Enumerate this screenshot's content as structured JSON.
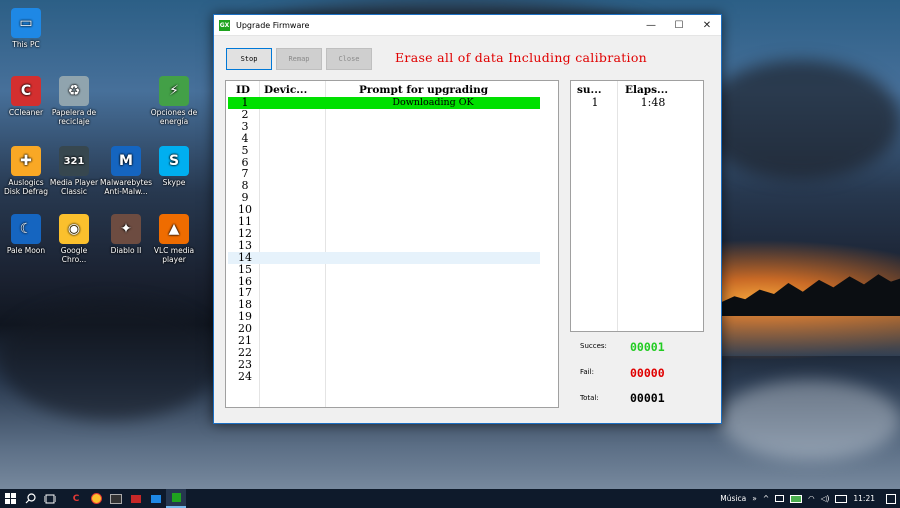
{
  "desktop": {
    "icons": [
      {
        "label": "This PC",
        "color": "#1e88e5",
        "glyph": "▭"
      },
      {
        "label": "CCleaner",
        "color": "#d32f2f",
        "glyph": "C"
      },
      {
        "label": "Papelera de reciclaje",
        "color": "#90a4ae",
        "glyph": "♻"
      },
      {
        "label": "Opciones de energía",
        "color": "#43a047",
        "glyph": "⚡"
      },
      {
        "label": "Auslogics Disk Defrag",
        "color": "#f9a825",
        "glyph": "✚"
      },
      {
        "label": "Media Player Classic",
        "color": "#37474f",
        "glyph": "321"
      },
      {
        "label": "Malwarebytes Anti-Malw...",
        "color": "#1565c0",
        "glyph": "M"
      },
      {
        "label": "Skype",
        "color": "#00aff0",
        "glyph": "S"
      },
      {
        "label": "Pale Moon",
        "color": "#1565c0",
        "glyph": "☾"
      },
      {
        "label": "Google Chro...",
        "color": "#fbc02d",
        "glyph": "◉"
      },
      {
        "label": "Diablo II",
        "color": "#6d4c41",
        "glyph": "✦"
      },
      {
        "label": "VLC media player",
        "color": "#ef6c00",
        "glyph": "▲"
      }
    ]
  },
  "window": {
    "title": "Upgrade Firmware",
    "app_icon_text": "GX",
    "minimize": "—",
    "maximize": "☐",
    "close": "✕"
  },
  "toolbar": {
    "stop_label": "Stop",
    "remap_label": "Remap",
    "close_label": "Close",
    "warning": "Erase all of data Including calibration"
  },
  "main_table": {
    "headers": {
      "id": "ID",
      "device": "Devic...",
      "prompt": "Prompt for upgrading"
    },
    "rows": [
      {
        "id": "1",
        "prompt": "Downloading OK",
        "status": "ok"
      },
      {
        "id": "2",
        "prompt": ""
      },
      {
        "id": "3",
        "prompt": ""
      },
      {
        "id": "4",
        "prompt": ""
      },
      {
        "id": "5",
        "prompt": ""
      },
      {
        "id": "6",
        "prompt": ""
      },
      {
        "id": "7",
        "prompt": ""
      },
      {
        "id": "8",
        "prompt": ""
      },
      {
        "id": "9",
        "prompt": ""
      },
      {
        "id": "10",
        "prompt": ""
      },
      {
        "id": "11",
        "prompt": ""
      },
      {
        "id": "12",
        "prompt": ""
      },
      {
        "id": "13",
        "prompt": ""
      },
      {
        "id": "14",
        "prompt": "",
        "status": "selected"
      },
      {
        "id": "15",
        "prompt": ""
      },
      {
        "id": "16",
        "prompt": ""
      },
      {
        "id": "17",
        "prompt": ""
      },
      {
        "id": "18",
        "prompt": ""
      },
      {
        "id": "19",
        "prompt": ""
      },
      {
        "id": "20",
        "prompt": ""
      },
      {
        "id": "21",
        "prompt": ""
      },
      {
        "id": "22",
        "prompt": ""
      },
      {
        "id": "23",
        "prompt": ""
      },
      {
        "id": "24",
        "prompt": ""
      }
    ]
  },
  "side_table": {
    "headers": {
      "success": "su...",
      "elapsed": "Elaps..."
    },
    "rows": [
      {
        "success": "1",
        "elapsed": "1:48"
      }
    ]
  },
  "stats": {
    "success_label": "Succes:",
    "success_value": "00001",
    "success_color": "#22cc22",
    "fail_label": "Fail:",
    "fail_value": "00000",
    "fail_color": "#e00000",
    "total_label": "Total:",
    "total_value": "00001",
    "total_color": "#000000"
  },
  "taskbar": {
    "items": [
      "windows-start",
      "search",
      "task-view",
      "ccleaner",
      "chrome",
      "terminal",
      "media",
      "mail",
      "upgrade-firmware"
    ],
    "tray_label": "Música",
    "tray_chevron": "»",
    "time": "11:21"
  }
}
